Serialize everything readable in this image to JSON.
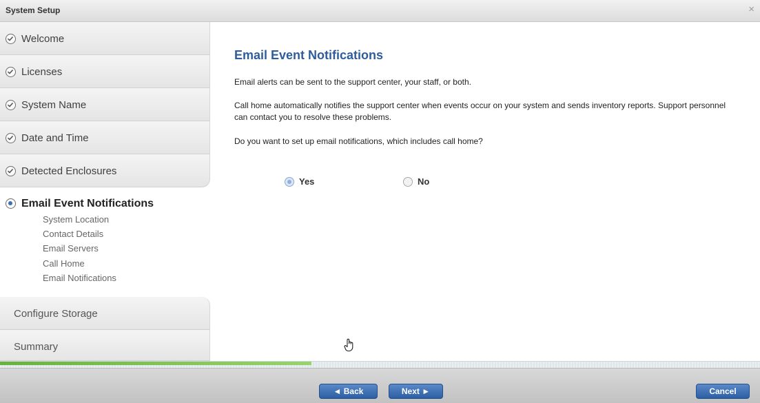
{
  "window": {
    "title": "System Setup",
    "close_glyph": "×"
  },
  "sidebar": {
    "completed_steps": [
      {
        "label": "Welcome"
      },
      {
        "label": "Licenses"
      },
      {
        "label": "System Name"
      },
      {
        "label": "Date and Time"
      },
      {
        "label": "Detected Enclosures"
      }
    ],
    "active_step": {
      "label": "Email Event Notifications",
      "substeps": [
        "System Location",
        "Contact Details",
        "Email Servers",
        "Call Home",
        "Email Notifications"
      ]
    },
    "pending_steps": [
      {
        "label": "Configure Storage"
      },
      {
        "label": "Summary"
      }
    ]
  },
  "main": {
    "heading": "Email Event Notifications",
    "paragraph_1": "Email alerts can be sent to the support center, your staff, or both.",
    "paragraph_2": "Call home automatically notifies the support center when events occur on your system and sends inventory reports. Support personnel can contact you to resolve these problems.",
    "question": "Do you want to set up email notifications, which includes call home?",
    "options": [
      {
        "label": "Yes",
        "selected": true
      },
      {
        "label": "No",
        "selected": false
      }
    ]
  },
  "progress": {
    "fraction": 0.41,
    "color": "#68b33a"
  },
  "footer": {
    "back_label": "◄ Back",
    "next_label": "Next ►",
    "cancel_label": "Cancel"
  },
  "colors": {
    "accent": "#2f5c9c",
    "button": "#3a6cb3"
  },
  "icons": {
    "check": "check-circle-icon",
    "current": "current-step-icon",
    "pointer": "hand-pointer-icon"
  }
}
